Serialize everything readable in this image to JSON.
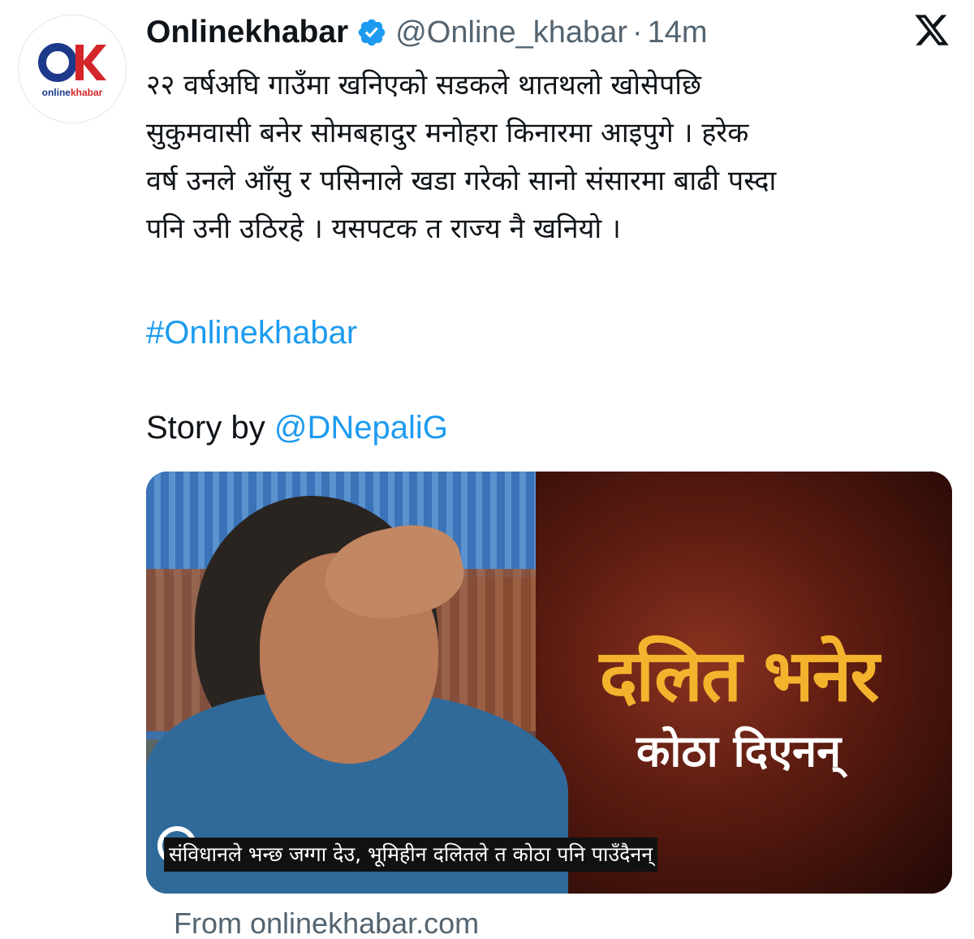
{
  "account": {
    "name": "Onlinekhabar",
    "handle": "@Online_khabar",
    "separator": "·",
    "time": "14m",
    "avatar_text_part1": "online",
    "avatar_text_part2": "khabar"
  },
  "tweet": {
    "text": "२२ वर्षअघि गाउँमा खनिएको सडकले थातथलो खोसेपछि\nसुकुमवासी बनेर सोमबहादुर मनोहरा किनारमा आइपुगे । हरेक\nवर्ष उनले आँसु र पसिनाले खडा गरेको सानो संसारमा बाढी पस्दा\nपनि उनी उठिरहे । यसपटक त राज्य नै खनियो ।",
    "hashtag": "#Onlinekhabar",
    "story_prefix": "Story by ",
    "story_mention": "@DNepaliG"
  },
  "card": {
    "headline": "दलित भनेर",
    "subhead": "कोठा दिएनन्",
    "caption": "संविधानले भन्छ जग्गा देउ, भूमिहीन दलितले त कोठा पनि पाउँदैनन्",
    "source": "From onlinekhabar.com"
  },
  "colors": {
    "link": "#1d9bf0",
    "secondary_text": "#536471",
    "headline": "#f4b32d",
    "brand_blue": "#1d3a8a",
    "brand_red": "#d4252a"
  },
  "icons": {
    "verified": "verified-badge-icon",
    "platform": "x-logo-icon"
  }
}
